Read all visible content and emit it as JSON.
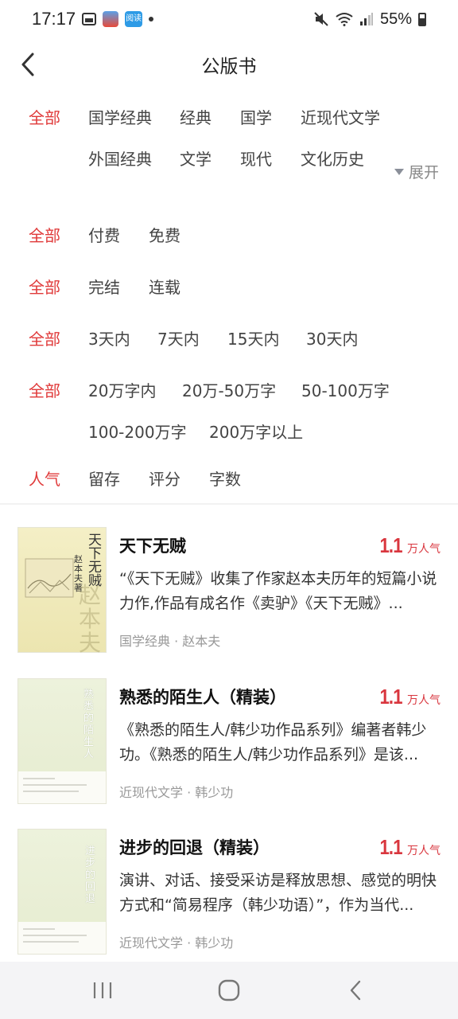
{
  "status_bar": {
    "time": "17:17",
    "app2_label": "阅读",
    "battery": "55%"
  },
  "header": {
    "title": "公版书"
  },
  "filters": [
    {
      "all": "全部",
      "options": [
        "国学经典",
        "经典",
        "国学",
        "近现代文学",
        "外国经典",
        "文学",
        "现代",
        "文化历史"
      ],
      "expand": "展开"
    },
    {
      "all": "全部",
      "options": [
        "付费",
        "免费"
      ]
    },
    {
      "all": "全部",
      "options": [
        "完结",
        "连载"
      ]
    },
    {
      "all": "全部",
      "options": [
        "3天内",
        "7天内",
        "15天内",
        "30天内"
      ]
    },
    {
      "all": "全部",
      "options": [
        "20万字内",
        "20万-50万字",
        "50-100万字",
        "100-200万字",
        "200万字以上"
      ]
    },
    {
      "all": "人气",
      "options": [
        "留存",
        "评分",
        "字数"
      ]
    }
  ],
  "books": [
    {
      "title": "天下无贼",
      "pop_num": "1.1",
      "pop_unit": "万人气",
      "desc": "“《天下无贼》收集了作家赵本夫历年的短篇小说力作,作品有成名作《卖驴》《天下无贼》...",
      "meta": "国学经典 · 赵本夫",
      "cover_title": "天下无贼",
      "cover_author": "赵本夫著",
      "cover_faint": "赵本夫"
    },
    {
      "title": "熟悉的陌生人（精装）",
      "pop_num": "1.1",
      "pop_unit": "万人气",
      "desc": "《熟悉的陌生人/韩少功作品系列》编著者韩少功。《熟悉的陌生人/韩少功作品系列》是该...",
      "meta": "近现代文学 · 韩少功",
      "cover_title": "熟悉的陌生人"
    },
    {
      "title": "进步的回退（精装）",
      "pop_num": "1.1",
      "pop_unit": "万人气",
      "desc": "演讲、对话、接受采访是释放思想、感觉的明快方式和“简易程序（韩少功语）”，作为当代...",
      "meta": "近现代文学 · 韩少功",
      "cover_title": "进步的回退"
    }
  ]
}
